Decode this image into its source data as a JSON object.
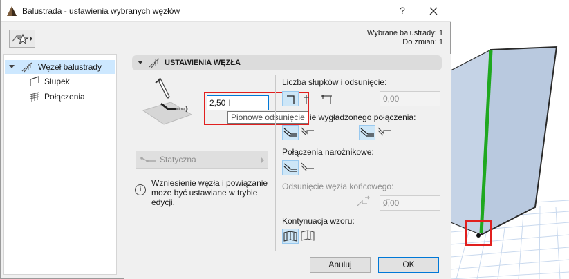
{
  "window": {
    "title": "Balustrada - ustawienia wybranych węzłów",
    "help_label": "?"
  },
  "selection_info": {
    "selected_label": "Wybrane balustrady: 1",
    "to_change_label": "Do zmian: 1"
  },
  "tree": {
    "items": [
      {
        "label": "Węzeł balustrady",
        "selected": true
      },
      {
        "label": "Słupek",
        "selected": false
      },
      {
        "label": "Połączenia",
        "selected": false
      }
    ]
  },
  "section": {
    "title": "USTAWIENIA WĘZŁA"
  },
  "offset": {
    "value": "2,50",
    "tooltip": "Pionowe odsunięcie"
  },
  "static_dropdown": {
    "label": "Statyczna"
  },
  "info": {
    "icon": "i",
    "text": "Wzniesienie węzła i powiązanie może być ustawiane w trybie edycji."
  },
  "posts": {
    "label": "Liczba słupków i odsunięcie:",
    "value": "0,00"
  },
  "smooth": {
    "label": "ie wygładzonego połączenia:"
  },
  "corner": {
    "label": "Połączenia narożnikowe:"
  },
  "end_offset": {
    "label": "Odsunięcie węzła końcowego:",
    "value": "0,00"
  },
  "pattern": {
    "label": "Kontynuacja wzoru:"
  },
  "buttons": {
    "cancel": "Anuluj",
    "ok": "OK"
  },
  "colors": {
    "highlight": "#e1201f",
    "selection": "#cde8ff",
    "accent": "#0078d7",
    "rail_green": "#1fa81f",
    "panel_fill": "#c5d3e6"
  },
  "icons": {
    "app": "archicad-icon",
    "close": "close-icon",
    "favorites": "favorites-icon",
    "node": "railing-node-icon",
    "post": "post-icon",
    "connections": "connections-icon",
    "info": "info-icon"
  }
}
